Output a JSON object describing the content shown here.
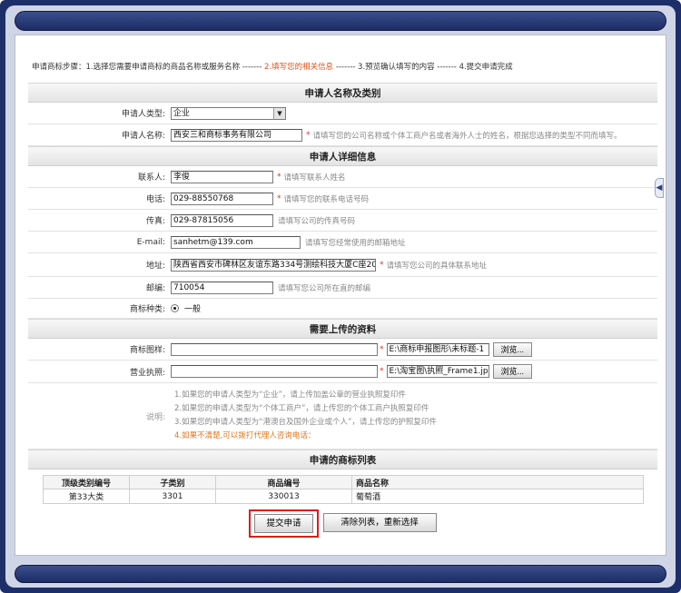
{
  "steps": {
    "prefix": "申请商标步骤：",
    "step1": "1.选择您需要申请商标的商品名称或服务名称",
    "sep": "-------",
    "step2": "2.填写您的相关信息",
    "step3": "3.预览确认填写的内容",
    "step4": "4.提交申请完成"
  },
  "sections": {
    "applicant": "申请人名称及类别",
    "details": "申请人详细信息",
    "uploads": "需要上传的资料",
    "list": "申请的商标列表"
  },
  "fields": {
    "type": {
      "label": "申请人类型:",
      "value": "企业"
    },
    "name": {
      "label": "申请人名称:",
      "value": "西安三和商标事务有限公司",
      "hint": "请填写您的公司名称或个体工商户名或者海外人士的姓名，根据您选择的类型不同而填写。"
    },
    "contact": {
      "label": "联系人:",
      "value": "李俊",
      "hint": "请填写联系人姓名"
    },
    "phone": {
      "label": "电话:",
      "value": "029-88550768",
      "hint": "请填写您的联系电话号码"
    },
    "fax": {
      "label": "传真:",
      "value": "029-87815056",
      "hint": "请填写公司的传真号码"
    },
    "email": {
      "label": "E-mail:",
      "value": "sanhetm@139.com",
      "hint": "请填写您经常使用的邮箱地址"
    },
    "address": {
      "label": "地址:",
      "value": "陕西省西安市碑林区友谊东路334号测绘科技大厦C座20",
      "hint": "请填写您公司的具体联系地址"
    },
    "zip": {
      "label": "邮编:",
      "value": "710054",
      "hint": "请填写您公司所在直的邮编"
    },
    "kind": {
      "label": "商标种类:",
      "value": "一般"
    },
    "trademark_image": {
      "label": "商标图样:",
      "path": "E:\\商标申报图形\\未标题-1",
      "browse": "浏览..."
    },
    "license": {
      "label": "营业执照:",
      "path": "E:\\淘宝图\\执照_Frame1.jp",
      "browse": "浏览..."
    }
  },
  "notes": {
    "label": "说明:",
    "line1": "1.如果您的申请人类型为“企业”，请上传加盖公章的营业执照复印件",
    "line2": "2.如果您的申请人类型为“个体工商户”，请上传您的个体工商户执照复印件",
    "line3": "3.如果您的申请人类型为“港澳台及国外企业或个人”，请上传您的护照复印件",
    "line4": "4.如果不清楚,可以拨打代理人咨询电话："
  },
  "table": {
    "headers": [
      "顶级类别编号",
      "子类别",
      "商品编号",
      "商品名称"
    ],
    "rows": [
      [
        "第33大类",
        "3301",
        "330013",
        "葡萄酒"
      ]
    ]
  },
  "buttons": {
    "submit": "提交申请",
    "clear": "清除列表，重新选择"
  },
  "side_tab": "◀"
}
